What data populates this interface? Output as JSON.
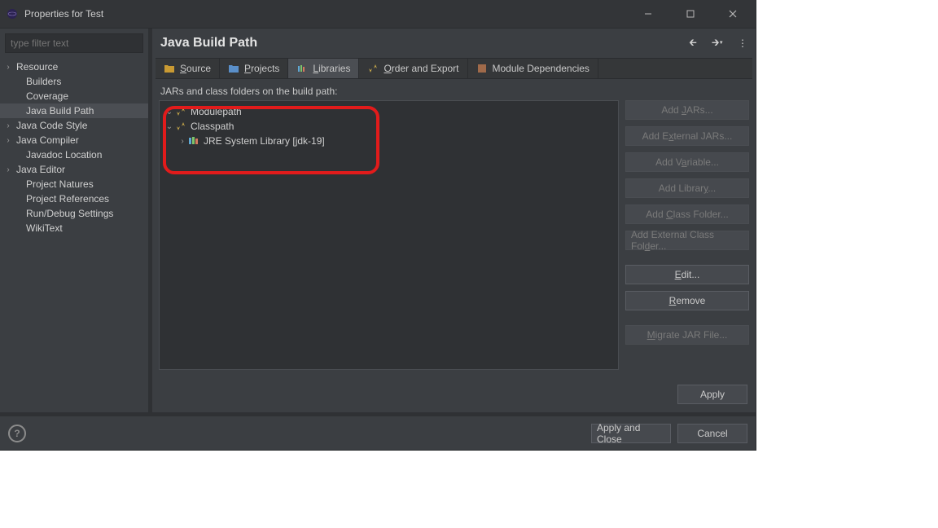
{
  "window": {
    "title": "Properties for Test"
  },
  "sidebar": {
    "filter_placeholder": "type filter text",
    "items": [
      {
        "label": "Resource",
        "hasChildren": true
      },
      {
        "label": "Builders"
      },
      {
        "label": "Coverage"
      },
      {
        "label": "Java Build Path",
        "selected": true
      },
      {
        "label": "Java Code Style",
        "hasChildren": true
      },
      {
        "label": "Java Compiler",
        "hasChildren": true
      },
      {
        "label": "Javadoc Location"
      },
      {
        "label": "Java Editor",
        "hasChildren": true
      },
      {
        "label": "Project Natures"
      },
      {
        "label": "Project References"
      },
      {
        "label": "Run/Debug Settings"
      },
      {
        "label": "WikiText"
      }
    ]
  },
  "header": {
    "title": "Java Build Path"
  },
  "tabs": [
    {
      "icon": "source-folder-icon",
      "label": "Source",
      "u": "S"
    },
    {
      "icon": "projects-icon",
      "label": "Projects",
      "u": "P"
    },
    {
      "icon": "libraries-icon",
      "label": "Libraries",
      "u": "L",
      "active": true
    },
    {
      "icon": "order-export-icon",
      "label": "Order and Export",
      "u": "O"
    },
    {
      "icon": "module-deps-icon",
      "label": "Module Dependencies"
    }
  ],
  "libraries": {
    "description": "JARs and class folders on the build path:",
    "tree": [
      {
        "label": "Modulepath",
        "depth": 1,
        "expandedIcon": "down",
        "icon": "path-icon"
      },
      {
        "label": "Classpath",
        "depth": 1,
        "expandedIcon": "down",
        "icon": "path-icon"
      },
      {
        "label": "JRE System Library [jdk-19]",
        "depth": 2,
        "expandedIcon": "right",
        "icon": "library-icon"
      }
    ]
  },
  "buttons": {
    "add_jars": "Add JARs...",
    "add_external_jars": "Add External JARs...",
    "add_variable": "Add Variable...",
    "add_library": "Add Library...",
    "add_class_folder": "Add Class Folder...",
    "add_external_class_folder": "Add External Class Folder...",
    "edit": "Edit...",
    "remove": "Remove",
    "migrate": "Migrate JAR File...",
    "apply": "Apply",
    "apply_close": "Apply and Close",
    "cancel": "Cancel"
  }
}
